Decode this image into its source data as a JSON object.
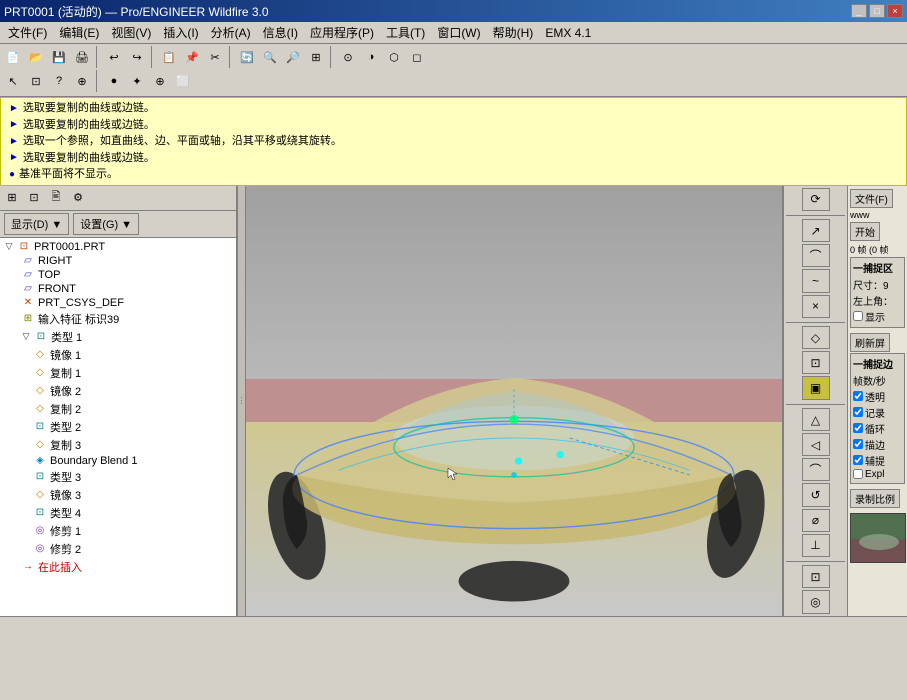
{
  "titlebar": {
    "title": "PRT0001 (活动的) — Pro/ENGINEER Wildfire 3.0",
    "controls": [
      "_",
      "□",
      "×"
    ]
  },
  "menubar": {
    "items": [
      "文件(F)",
      "编辑(E)",
      "视图(V)",
      "插入(I)",
      "分析(A)",
      "信息(I)",
      "应用程序(P)",
      "工具(T)",
      "窗口(W)",
      "帮助(H)",
      "EMX 4.1"
    ]
  },
  "infobar": {
    "lines": [
      "选取要复制的曲线或边链。",
      "选取要复制的曲线或边链。",
      "选取一个参照，如直曲线、边、平面或轴，沿其平移或绕其旋转。",
      "选取要复制的曲线或边链。",
      "基准平面将不显示。"
    ]
  },
  "left_panel": {
    "display_btn": "显示(D) ▼",
    "settings_btn": "设置(G) ▼",
    "tree": {
      "root": "PRT0001.PRT",
      "items": [
        {
          "id": "right",
          "label": "RIGHT",
          "icon": "▱",
          "indent": 1
        },
        {
          "id": "top",
          "label": "TOP",
          "icon": "▱",
          "indent": 1
        },
        {
          "id": "front",
          "label": "FRONT",
          "icon": "▱",
          "indent": 1
        },
        {
          "id": "prt_csys",
          "label": "PRT_CSYS_DEF",
          "icon": "✕",
          "indent": 1
        },
        {
          "id": "import",
          "label": "输入特征 标识39",
          "icon": "⊞",
          "indent": 1
        },
        {
          "id": "type1",
          "label": "类型 1",
          "icon": "▽",
          "indent": 1,
          "expandable": true
        },
        {
          "id": "mirror1",
          "label": "镜像 1",
          "icon": "◇",
          "indent": 2
        },
        {
          "id": "copy1",
          "label": "复制 1",
          "icon": "◇",
          "indent": 2
        },
        {
          "id": "mirror2",
          "label": "镜像 2",
          "icon": "◇",
          "indent": 2
        },
        {
          "id": "copy2",
          "label": "复制 2",
          "icon": "◇",
          "indent": 2
        },
        {
          "id": "type2",
          "label": "类型 2",
          "icon": "▽",
          "indent": 2
        },
        {
          "id": "copy3",
          "label": "复制 3",
          "icon": "◇",
          "indent": 2
        },
        {
          "id": "bb1",
          "label": "Boundary Blend 1",
          "icon": "◈",
          "indent": 2
        },
        {
          "id": "type3",
          "label": "类型 3",
          "icon": "▽",
          "indent": 2
        },
        {
          "id": "mirror3",
          "label": "镜像 3",
          "icon": "◇",
          "indent": 2
        },
        {
          "id": "type4",
          "label": "类型 4",
          "icon": "▽",
          "indent": 2
        },
        {
          "id": "trim1",
          "label": "修剪 1",
          "icon": "◎",
          "indent": 2
        },
        {
          "id": "trim2",
          "label": "修剪 2",
          "icon": "◎",
          "indent": 2
        },
        {
          "id": "insert",
          "label": "在此插入",
          "icon": "→",
          "indent": 1,
          "color": "red"
        }
      ]
    }
  },
  "right_panel": {
    "buttons": [
      "⟳",
      "↗",
      "↘",
      "✕",
      "⊕",
      "○",
      "⌒",
      "~",
      "×",
      "◇",
      "⊡",
      "▣",
      "△",
      "◁",
      "⌒",
      "↺",
      "⌀",
      "⊥"
    ]
  },
  "far_right": {
    "file_label": "文件(F)",
    "www_label": "www",
    "start_btn": "开始",
    "frames": "0 帧 (0 帧",
    "capture_section": "一捕捉区",
    "size_label": "尺寸：9",
    "topleft_label": "左上角：",
    "display_check": "厂 显示",
    "refresh_btn": "刷新屏",
    "capture2": "一捕捉边",
    "fps_label": "帧数/秒",
    "transparent_check": "☑ 透明",
    "record_check": "☑ 记录",
    "loop_check": "☑ 循环",
    "trace_check": "☑ 描边",
    "assist_check": "☑ 辅提",
    "expl_check": "厂 Expl",
    "record_btn": "录制比例"
  },
  "statusbar": {
    "text": ""
  },
  "colors": {
    "accent_blue": "#0a246a",
    "toolbar_bg": "#d4d0c8",
    "info_bg": "#ffffc0",
    "viewport_gray": "#b0b0b0"
  }
}
